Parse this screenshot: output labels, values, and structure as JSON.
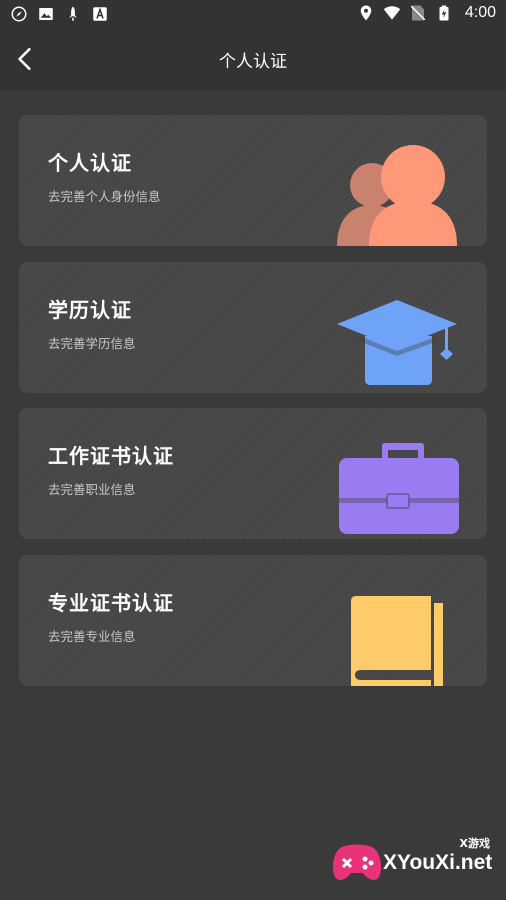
{
  "status_bar": {
    "time": "4:00",
    "left_icons": [
      "compass-icon",
      "image-icon",
      "rocket-icon",
      "font-icon"
    ],
    "right_icons": [
      "location-icon",
      "wifi-icon",
      "sim-off-icon",
      "battery-charging-icon"
    ]
  },
  "header": {
    "title": "个人认证",
    "back_icon": "chevron-left-icon"
  },
  "cards": [
    {
      "title": "个人认证",
      "subtitle": "去完善个人身份信息",
      "icon": "people-icon",
      "color": "#FF9878",
      "color2": "#C9826D"
    },
    {
      "title": "学历认证",
      "subtitle": "去完善学历信息",
      "icon": "graduation-cap-icon",
      "color": "#6FA3F7"
    },
    {
      "title": "工作证书认证",
      "subtitle": "去完善职业信息",
      "icon": "briefcase-icon",
      "color": "#9B7BF2"
    },
    {
      "title": "专业证书认证",
      "subtitle": "去完善专业信息",
      "icon": "book-icon",
      "color": "#FDCB6A"
    }
  ],
  "watermark": {
    "small": "X游戏",
    "text": "XYouXi.net"
  }
}
